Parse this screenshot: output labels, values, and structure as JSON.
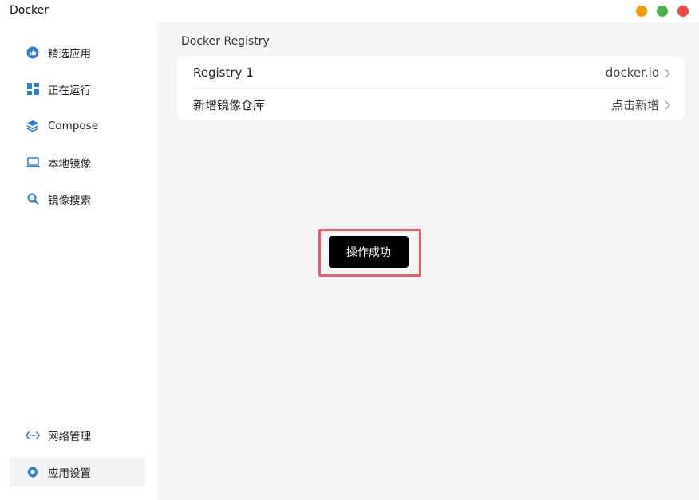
{
  "window": {
    "title": "Docker",
    "controls": {
      "minimize_color": "#f59b0b",
      "maximize_color": "#4caf50",
      "close_color": "#ef4444"
    }
  },
  "sidebar": {
    "accent": "#2f80d1",
    "items": [
      {
        "label": "精选应用",
        "icon": "thumbs-up-icon"
      },
      {
        "label": "正在运行",
        "icon": "grid-icon"
      },
      {
        "label": "Compose",
        "icon": "layers-icon"
      },
      {
        "label": "本地镜像",
        "icon": "laptop-icon"
      },
      {
        "label": "镜像搜索",
        "icon": "search-icon"
      }
    ],
    "bottom_items": [
      {
        "label": "网络管理",
        "icon": "network-icon"
      },
      {
        "label": "应用设置",
        "icon": "gear-icon",
        "active": true
      }
    ]
  },
  "main": {
    "section_title": "Docker Registry",
    "rows": [
      {
        "label": "Registry 1",
        "value": "docker.io"
      },
      {
        "label": "新增镜像仓库",
        "value": "点击新增"
      }
    ]
  },
  "toast": {
    "message": "操作成功"
  }
}
